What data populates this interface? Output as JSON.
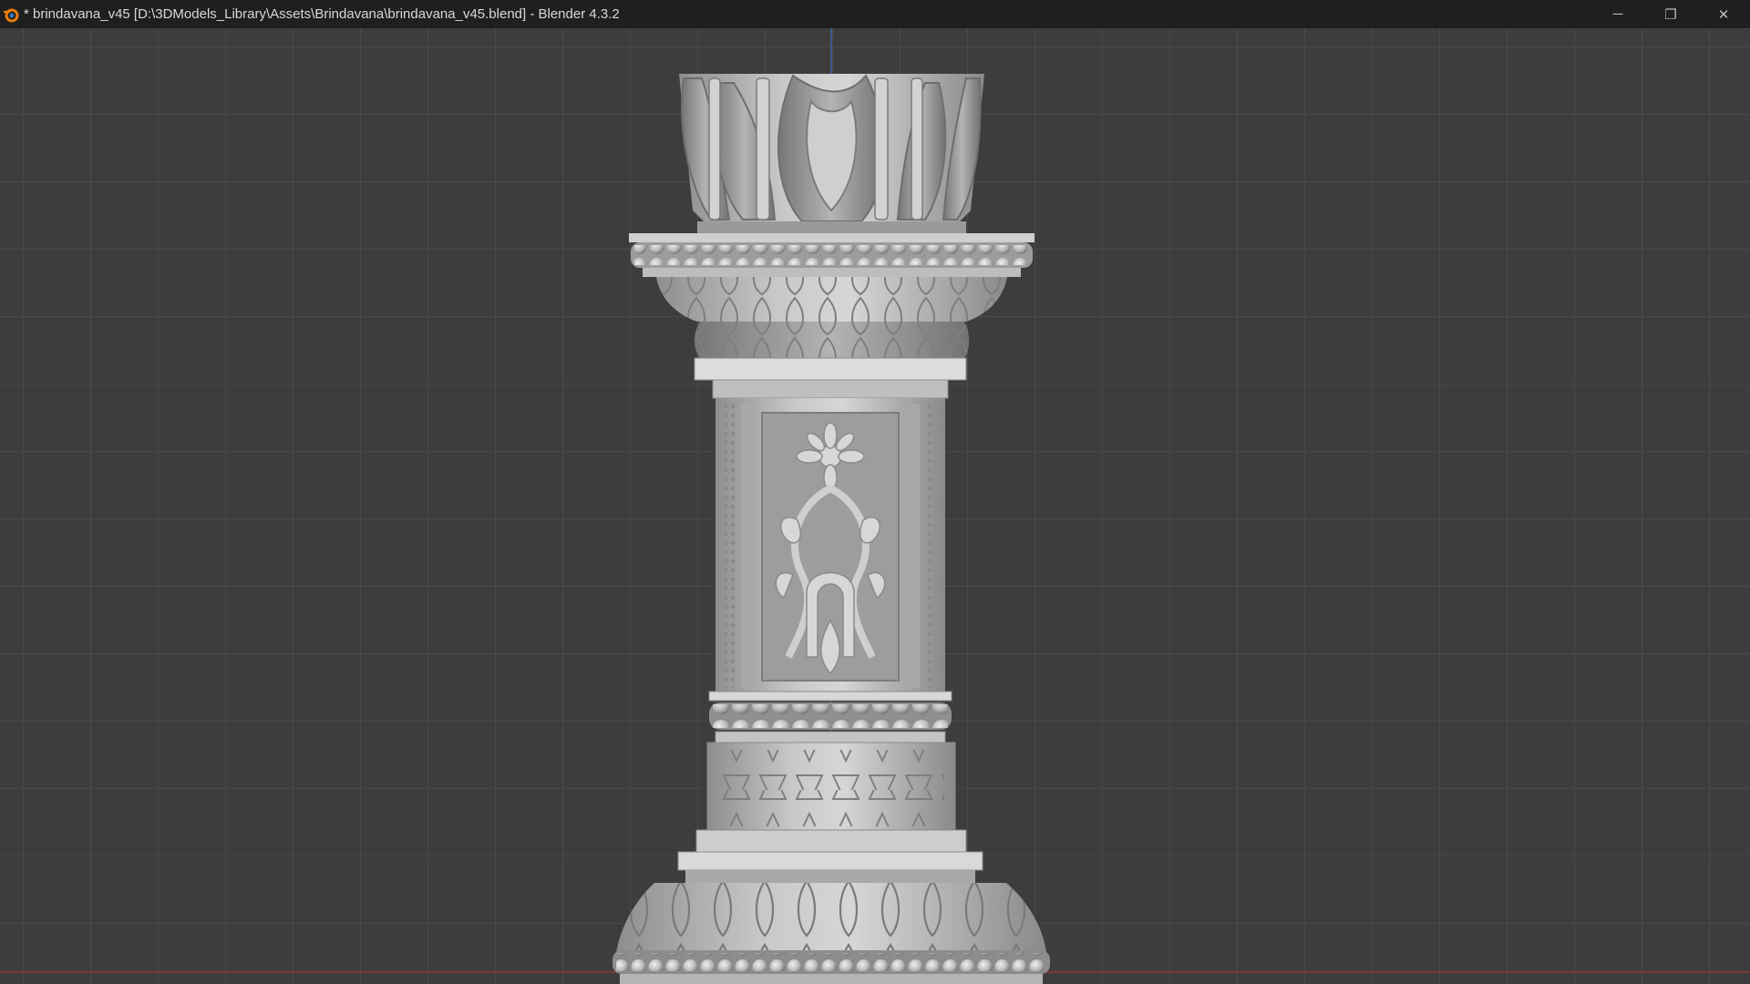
{
  "window": {
    "title": "* brindavana_v45 [D:\\3DModels_Library\\Assets\\Brindavana\\brindavana_v45.blend] - Blender 4.3.2",
    "app_icon": "blender-icon",
    "controls": {
      "minimize_icon": "minimize-icon",
      "maximize_icon": "restore-icon",
      "close_icon": "close-icon",
      "minimize_glyph": "─",
      "maximize_glyph": "❐",
      "close_glyph": "✕"
    }
  },
  "viewport": {
    "grid": true,
    "colors": {
      "background": "#3d3d3d",
      "grid": "#4a4a4a",
      "y_axis": "#3e5a86",
      "x_axis": "#7a3a3a",
      "model": "#b9b9b9"
    },
    "object": "brindavana"
  }
}
